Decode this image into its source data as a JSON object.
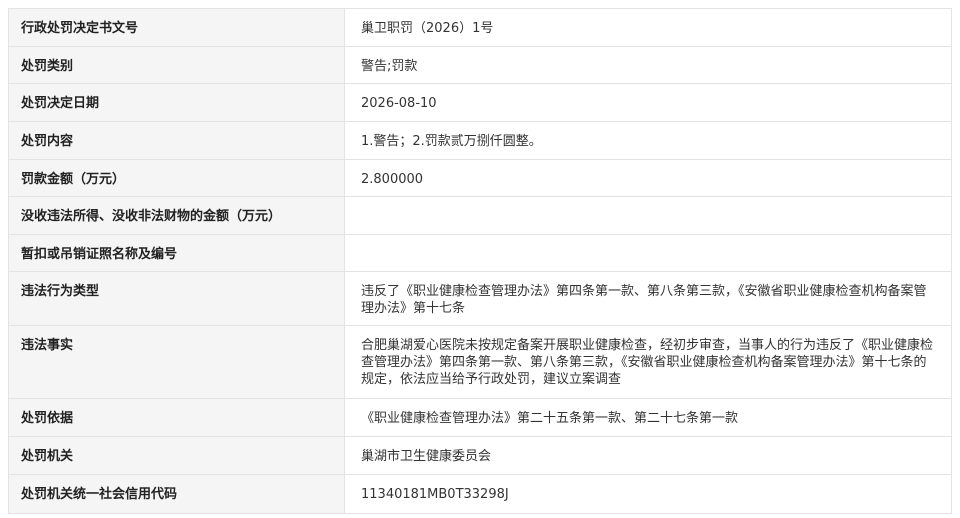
{
  "rows": [
    {
      "label": "行政处罚决定书文号",
      "value": "巢卫职罚（2026）1号"
    },
    {
      "label": "处罚类别",
      "value": "警告;罚款"
    },
    {
      "label": "处罚决定日期",
      "value": "2026-08-10"
    },
    {
      "label": "处罚内容",
      "value": "1.警告；2.罚款贰万捌仟圆整。"
    },
    {
      "label": "罚款金额（万元）",
      "value": "2.800000"
    },
    {
      "label": "没收违法所得、没收非法财物的金额（万元）",
      "value": ""
    },
    {
      "label": "暂扣或吊销证照名称及编号",
      "value": ""
    },
    {
      "label": "违法行为类型",
      "value": "违反了《职业健康检查管理办法》第四条第一款、第八条第三款，《安徽省职业健康检查机构备案管理办法》第十七条"
    },
    {
      "label": "违法事实",
      "value": "合肥巢湖爱心医院未按规定备案开展职业健康检查，经初步审查，当事人的行为违反了《职业健康检查管理办法》第四条第一款、第八条第三款，《安徽省职业健康检查机构备案管理办法》第十七条的规定，依法应当给予行政处罚，建议立案调查"
    },
    {
      "label": "处罚依据",
      "value": "《职业健康检查管理办法》第二十五条第一款、第二十七条第一款"
    },
    {
      "label": "处罚机关",
      "value": "巢湖市卫生健康委员会"
    },
    {
      "label": "处罚机关统一社会信用代码",
      "value": "11340181MB0T33298J"
    }
  ]
}
